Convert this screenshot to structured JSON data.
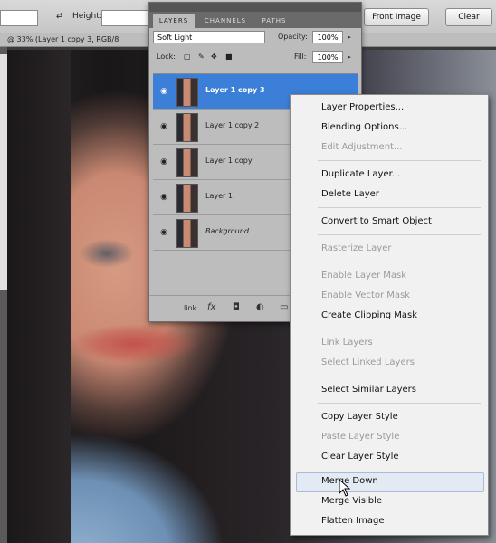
{
  "optionsbar": {
    "height_label": "Height:",
    "front_image_label": "Front Image",
    "clear_label": "Clear"
  },
  "document_tab": "@ 33% (Layer 1 copy 3, RGB/8",
  "layers_panel": {
    "tabs": [
      "LAYERS",
      "CHANNELS",
      "PATHS"
    ],
    "blend_mode": "Soft Light",
    "opacity_label": "Opacity:",
    "opacity_value": "100%",
    "lock_label": "Lock:",
    "fill_label": "Fill:",
    "fill_value": "100%",
    "layers": [
      {
        "name": "Layer 1 copy 3",
        "selected": true,
        "italic": false
      },
      {
        "name": "Layer 1 copy 2",
        "selected": false,
        "italic": false
      },
      {
        "name": "Layer 1 copy",
        "selected": false,
        "italic": false
      },
      {
        "name": "Layer 1",
        "selected": false,
        "italic": false
      },
      {
        "name": "Background",
        "selected": false,
        "italic": true
      }
    ],
    "link_label": "link",
    "fx_label": "fx"
  },
  "context_menu": {
    "items": [
      {
        "label": "Layer Properties...",
        "disabled": false
      },
      {
        "label": "Blending Options...",
        "disabled": false
      },
      {
        "label": "Edit Adjustment...",
        "disabled": true
      },
      {
        "label": "Duplicate Layer...",
        "disabled": false
      },
      {
        "label": "Delete Layer",
        "disabled": false
      },
      {
        "label": "Convert to Smart Object",
        "disabled": false
      },
      {
        "label": "Rasterize Layer",
        "disabled": true
      },
      {
        "label": "Enable Layer Mask",
        "disabled": true
      },
      {
        "label": "Enable Vector Mask",
        "disabled": true
      },
      {
        "label": "Create Clipping Mask",
        "disabled": false
      },
      {
        "label": "Link Layers",
        "disabled": true
      },
      {
        "label": "Select Linked Layers",
        "disabled": true
      },
      {
        "label": "Select Similar Layers",
        "disabled": false
      },
      {
        "label": "Copy Layer Style",
        "disabled": false
      },
      {
        "label": "Paste Layer Style",
        "disabled": true
      },
      {
        "label": "Clear Layer Style",
        "disabled": false
      },
      {
        "label": "Merge Down",
        "disabled": false,
        "highlighted": true
      },
      {
        "label": "Merge Visible",
        "disabled": false
      },
      {
        "label": "Flatten Image",
        "disabled": false
      }
    ]
  },
  "colors": {
    "selection": "#3c7fd9",
    "menu_highlight": "#e3eaf4",
    "disabled_text": "#9a9a9a"
  }
}
